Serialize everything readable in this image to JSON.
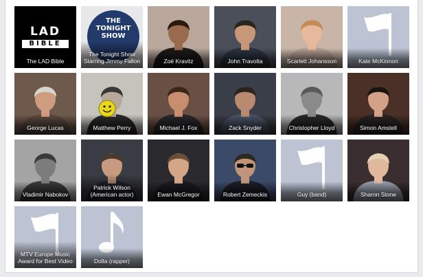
{
  "grid": {
    "tiles": [
      {
        "label": "The LAD Bible",
        "kind": "logo-lad",
        "bg": "#000000"
      },
      {
        "label": "The Tonight Show Starring Jimmy Fallon",
        "kind": "logo-tonight",
        "bg": "#e8e8ea"
      },
      {
        "label": "Zoë Kravitz",
        "kind": "person",
        "bg": "#b9a79c",
        "hair": "#2a1a12",
        "skin": "#9a6a4e",
        "shirt": "#1e1a1a"
      },
      {
        "label": "John Travolta",
        "kind": "person",
        "bg": "#4a4f5a",
        "hair": "#2a2420",
        "skin": "#c79878",
        "shirt": "#2e3444"
      },
      {
        "label": "Scarlett Johansson",
        "kind": "person",
        "bg": "#c9b5a8",
        "hair": "#c68a52",
        "skin": "#e6b89c",
        "shirt": "#b8a196"
      },
      {
        "label": "Kate McKinnon",
        "kind": "generic-flag",
        "bg": "#bcc4d4"
      },
      {
        "label": "George Lucas",
        "kind": "person",
        "bg": "#6d5a4c",
        "hair": "#d8d4cf",
        "skin": "#d09c80",
        "shirt": "#5a4a40"
      },
      {
        "label": "Matthew Perry",
        "kind": "person-smiley",
        "bg": "#c6c2bc",
        "hair": "#3a3632",
        "skin": "#b8a89a",
        "shirt": "#2a2a2a"
      },
      {
        "label": "Michael J. Fox",
        "kind": "person",
        "bg": "#6a5044",
        "hair": "#3c2618",
        "skin": "#c88e70",
        "shirt": "#2a2a2e"
      },
      {
        "label": "Zack Snyder",
        "kind": "person",
        "bg": "#3a3e48",
        "hair": "#2a2420",
        "skin": "#b88a70",
        "shirt": "#4a5468"
      },
      {
        "label": "Christopher Lloyd",
        "kind": "person",
        "bg": "#b8b8b8",
        "hair": "#5a5a5a",
        "skin": "#8a8a8a",
        "shirt": "#2a2a2a"
      },
      {
        "label": "Simon Amstell",
        "kind": "person",
        "bg": "#4a3026",
        "hair": "#1a1410",
        "skin": "#d4a088",
        "shirt": "#2a2424"
      },
      {
        "label": "Vladimir Nabokov",
        "kind": "person",
        "bg": "#a4a4a4",
        "hair": "#3a3a3a",
        "skin": "#7c7c7c",
        "shirt": "#3a3a3a"
      },
      {
        "label": "Patrick Wilson (American actor)",
        "kind": "person",
        "bg": "#3a3c44",
        "hair": "#4a3a2e",
        "skin": "#c89a80",
        "shirt": "#24262c"
      },
      {
        "label": "Ewan McGregor",
        "kind": "person",
        "bg": "#2a2a2e",
        "hair": "#6a4e36",
        "skin": "#d4a688",
        "shirt": "#1c1c20"
      },
      {
        "label": "Robert Zemeckis",
        "kind": "person-shades",
        "bg": "#3a4a68",
        "hair": "#2e2822",
        "skin": "#c09478",
        "shirt": "#1c1e28"
      },
      {
        "label": "Guy (band)",
        "kind": "generic-flag",
        "bg": "#bcc4d4"
      },
      {
        "label": "Sharon Stone",
        "kind": "person",
        "bg": "#3a2e30",
        "hair": "#e2d2b2",
        "skin": "#e0b89e",
        "shirt": "#9aa0b0"
      },
      {
        "label": "MTV Europe Music Award for Best Video",
        "kind": "generic-flag",
        "bg": "#bcc4d4"
      },
      {
        "label": "Dolla (rapper)",
        "kind": "generic-note",
        "bg": "#bcc4d4"
      }
    ]
  },
  "logos": {
    "lad_line1": "LAD",
    "lad_line2": "BIBLE",
    "tonight_text": "THE TONIGHT SHOW"
  }
}
